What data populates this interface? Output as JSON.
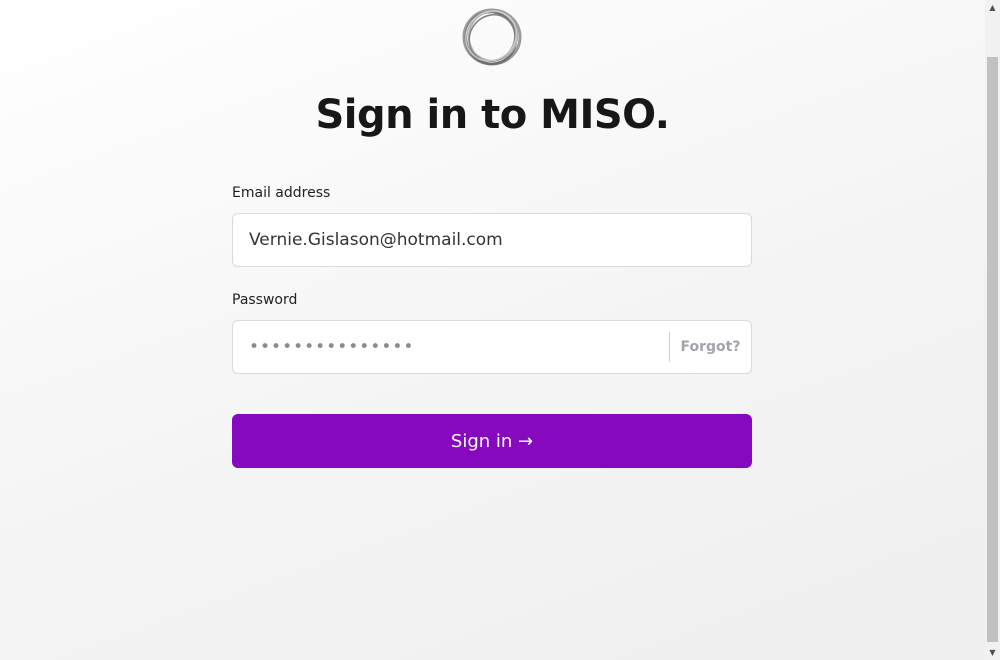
{
  "title": "Sign in to MISO.",
  "logo": {
    "icon": "miso-ring-logo"
  },
  "email": {
    "label": "Email address",
    "value": "Vernie.Gislason@hotmail.com"
  },
  "password": {
    "label": "Password",
    "value": "•••••••••••••••",
    "forgot_label": "Forgot?"
  },
  "submit": {
    "label": "Sign in →"
  },
  "colors": {
    "accent": "#8609bf"
  }
}
